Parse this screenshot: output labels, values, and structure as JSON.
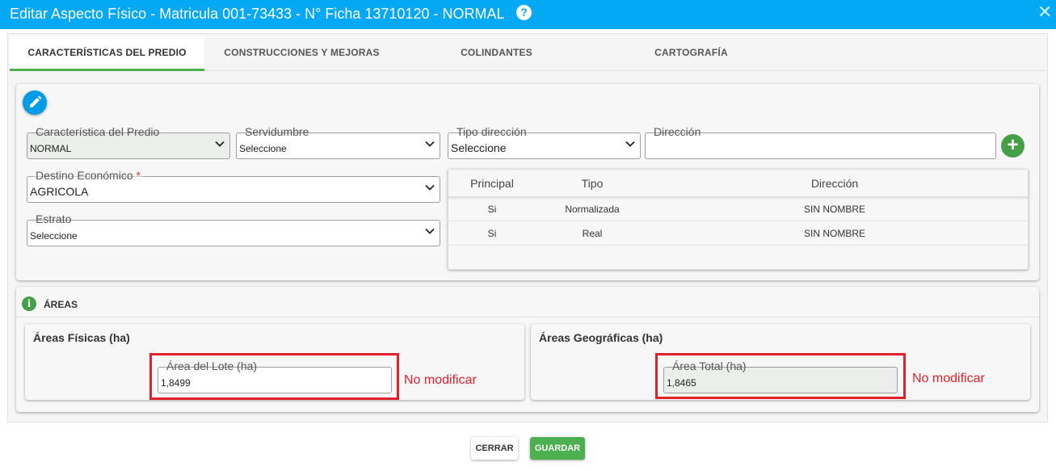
{
  "window": {
    "title": "Editar Aspecto Físico - Matricula 001-73433 - N° Ficha 13710120 - NORMAL",
    "help_icon": "?",
    "close_icon": "✕"
  },
  "tabs": [
    {
      "label": "CARACTERÍSTICAS DEL PREDIO",
      "active": true
    },
    {
      "label": "CONSTRUCCIONES Y MEJORAS",
      "active": false
    },
    {
      "label": "COLINDANTES",
      "active": false
    },
    {
      "label": "CARTOGRAFÍA",
      "active": false
    }
  ],
  "form": {
    "caracteristica": {
      "label": "Característica del Predio",
      "value": "NORMAL"
    },
    "servidumbre": {
      "label": "Servidumbre",
      "value": "Seleccione"
    },
    "tipo_direccion": {
      "label": "Tipo dirección",
      "value": "Seleccione"
    },
    "direccion": {
      "label": "Dirección",
      "value": ""
    },
    "destino": {
      "label": "Destino Económico",
      "required_mark": "*",
      "value": "AGRICOLA"
    },
    "estrato": {
      "label": "Estrato",
      "value": "Seleccione"
    },
    "add_icon": "+"
  },
  "direcciones_table": {
    "headers": [
      "Principal",
      "Tipo",
      "Dirección"
    ],
    "rows": [
      [
        "Si",
        "Normalizada",
        "SIN NOMBRE"
      ],
      [
        "Si",
        "Real",
        "SIN NOMBRE"
      ]
    ]
  },
  "areas": {
    "section_title": "ÁREAS",
    "info_icon": "i",
    "fisicas": {
      "title": "Áreas Físicas (ha)",
      "field_label": "Área del Lote (ha)",
      "value": "1,8499",
      "note": "No modificar"
    },
    "geograficas": {
      "title": "Áreas Geográficas (ha)",
      "field_label": "Área Total (ha)",
      "value": "1,8465",
      "note": "No modificar"
    }
  },
  "footer": {
    "cerrar": "CERRAR",
    "guardar": "GUARDAR"
  },
  "colors": {
    "titlebar": "#03a9f4",
    "accent_green": "#4caf50",
    "annotation_red": "#e0202a"
  }
}
